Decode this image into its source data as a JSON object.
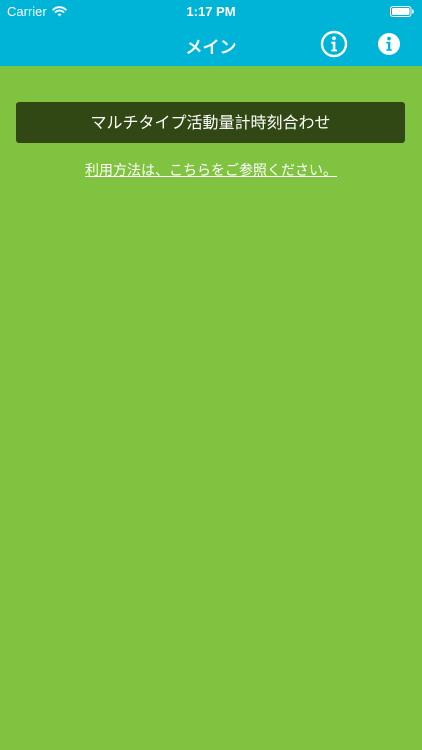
{
  "status_bar": {
    "carrier": "Carrier",
    "time": "1:17 PM",
    "wifi_icon": "wifi-icon",
    "battery_icon": "battery-icon"
  },
  "nav_bar": {
    "title": "メイン",
    "left_icon": "info-outline-icon",
    "right_icon": "info-filled-icon"
  },
  "main": {
    "sync_button_label": "マルチタイプ活動量計時刻合わせ",
    "help_link_text": "利用方法は、こちらをご参照ください。"
  },
  "colors": {
    "header": "#00b4d8",
    "background": "#80c341",
    "button": "#314815",
    "text": "#ffffff"
  }
}
